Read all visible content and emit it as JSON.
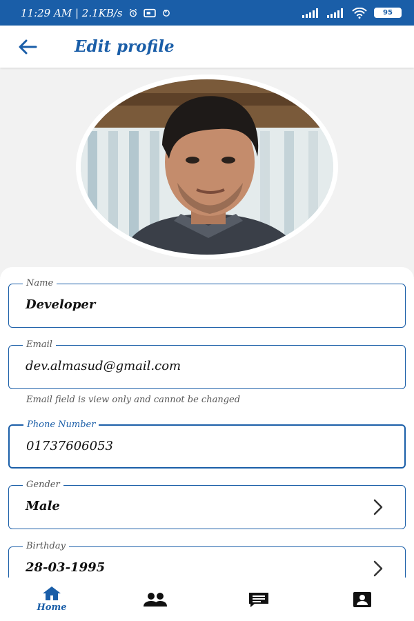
{
  "status_bar": {
    "time_speed": "11:29 AM | 2.1KB/s",
    "battery": "95",
    "icons": [
      "alarm-icon",
      "message-icon",
      "sync-icon",
      "signal-icon",
      "signal-icon",
      "wifi-icon",
      "battery-icon"
    ]
  },
  "app_bar": {
    "title": "Edit profile",
    "back_icon": "arrow-back-icon"
  },
  "profile": {
    "avatar_alt": "Profile photo"
  },
  "form": {
    "name": {
      "label": "Name",
      "value": "Developer"
    },
    "email": {
      "label": "Email",
      "value": "dev.almasud@gmail.com",
      "helper": "Email field is view only and cannot be changed"
    },
    "phone": {
      "label": "Phone Number",
      "value": "01737606053"
    },
    "gender": {
      "label": "Gender",
      "value": "Male"
    },
    "birthday": {
      "label": "Birthday",
      "value": "28-03-1995"
    }
  },
  "bottom_nav": {
    "items": [
      {
        "label": "Home",
        "icon": "home-icon",
        "active": true
      },
      {
        "label": "",
        "icon": "people-icon",
        "active": false
      },
      {
        "label": "",
        "icon": "chat-icon",
        "active": false
      },
      {
        "label": "",
        "icon": "contact-card-icon",
        "active": false
      }
    ]
  },
  "colors": {
    "primary": "#1a5ea8",
    "dark_icon": "#111111"
  }
}
